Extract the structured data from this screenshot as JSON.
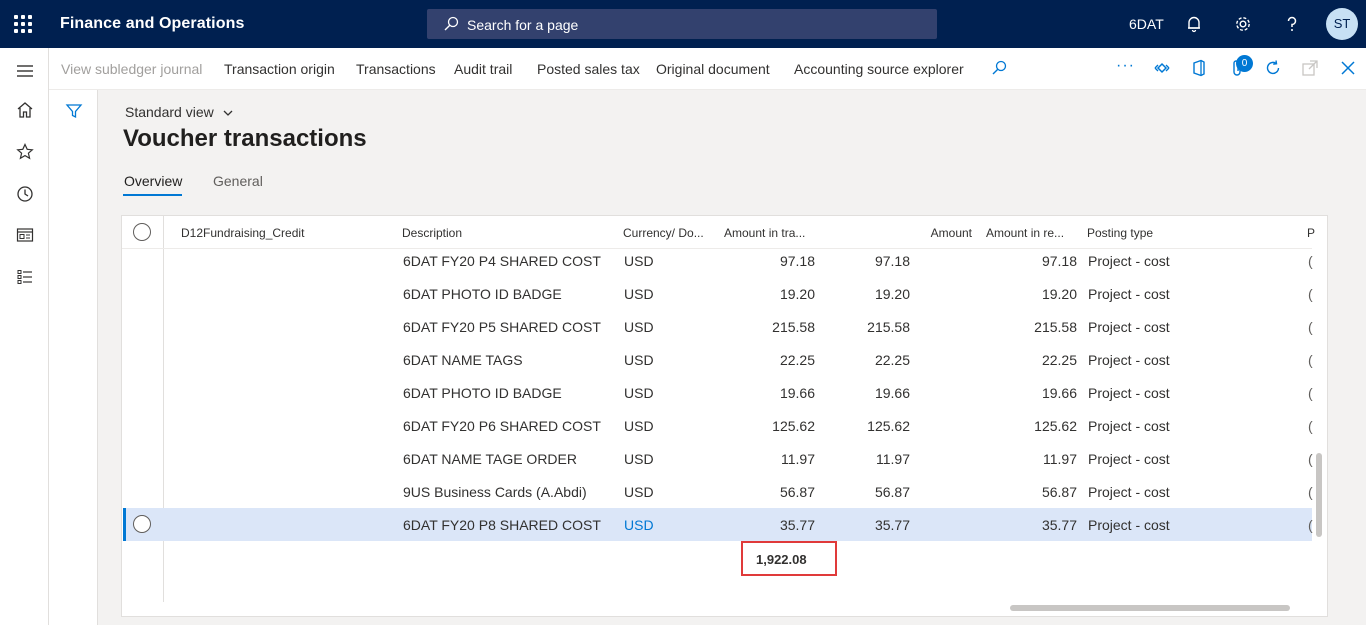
{
  "header": {
    "app_title": "Finance and Operations",
    "search_placeholder": "Search for a page",
    "company": "6DAT",
    "user_initials": "ST"
  },
  "actions": {
    "view_subledger": "View subledger journal",
    "transaction_origin": "Transaction origin",
    "transactions": "Transactions",
    "audit_trail": "Audit trail",
    "posted_sales_tax": "Posted sales tax",
    "original_document": "Original document",
    "accounting_source_explorer": "Accounting source explorer",
    "more": "···",
    "attachments_count": "0"
  },
  "page": {
    "view_name": "Standard view",
    "title": "Voucher transactions",
    "tabs": [
      "Overview",
      "General"
    ]
  },
  "grid": {
    "columns": {
      "account": "D12Fundraising_Credit",
      "description": "Description",
      "currency": "Currency/ Do...",
      "amount_tx": "Amount in tra...",
      "amount": "Amount",
      "amount_rep": "Amount in re...",
      "posting_type": "Posting type",
      "truncated": "P"
    },
    "rows": [
      {
        "description": "6DAT FY20 P4 SHARED COST",
        "currency": "USD",
        "amount_tx": "97.18",
        "amount": "97.18",
        "amount_rep": "97.18",
        "posting_type": "Project - cost"
      },
      {
        "description": "6DAT PHOTO ID BADGE",
        "currency": "USD",
        "amount_tx": "19.20",
        "amount": "19.20",
        "amount_rep": "19.20",
        "posting_type": "Project - cost"
      },
      {
        "description": "6DAT FY20 P5 SHARED COST",
        "currency": "USD",
        "amount_tx": "215.58",
        "amount": "215.58",
        "amount_rep": "215.58",
        "posting_type": "Project - cost"
      },
      {
        "description": "6DAT NAME TAGS",
        "currency": "USD",
        "amount_tx": "22.25",
        "amount": "22.25",
        "amount_rep": "22.25",
        "posting_type": "Project - cost"
      },
      {
        "description": "6DAT PHOTO ID BADGE",
        "currency": "USD",
        "amount_tx": "19.66",
        "amount": "19.66",
        "amount_rep": "19.66",
        "posting_type": "Project - cost"
      },
      {
        "description": "6DAT FY20 P6 SHARED COST",
        "currency": "USD",
        "amount_tx": "125.62",
        "amount": "125.62",
        "amount_rep": "125.62",
        "posting_type": "Project - cost"
      },
      {
        "description": "6DAT NAME TAGE ORDER",
        "currency": "USD",
        "amount_tx": "11.97",
        "amount": "11.97",
        "amount_rep": "11.97",
        "posting_type": "Project - cost"
      },
      {
        "description": "9US Business Cards (A.Abdi)",
        "currency": "USD",
        "amount_tx": "56.87",
        "amount": "56.87",
        "amount_rep": "56.87",
        "posting_type": "Project - cost"
      },
      {
        "description": "6DAT FY20 P8 SHARED COST",
        "currency": "USD",
        "amount_tx": "35.77",
        "amount": "35.77",
        "amount_rep": "35.77",
        "posting_type": "Project - cost"
      }
    ],
    "selected_row": 8,
    "total": "1,922.08"
  },
  "colors": {
    "topbar": "#002050",
    "accent": "#0078d4",
    "selected_row": "#dbe6f8",
    "highlight_box": "#e03a3a"
  }
}
